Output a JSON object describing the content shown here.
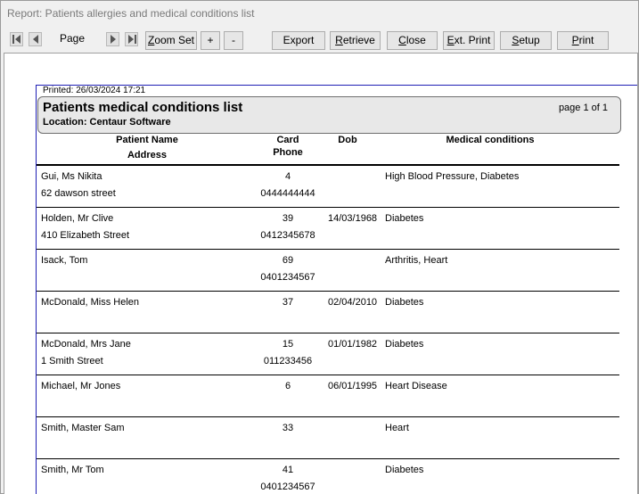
{
  "window": {
    "title": "Report: Patients allergies and medical conditions list"
  },
  "toolbar": {
    "page_label": "Page",
    "zoom_set": "Zoom Set",
    "zoom_in": "+",
    "zoom_out": "-",
    "export": "Export",
    "retrieve": "Retrieve",
    "close": "Close",
    "ext_print": "Ext. Print",
    "setup": "Setup",
    "print": "Print"
  },
  "report": {
    "printed": "Printed: 26/03/2024 17:21",
    "title": "Patients medical conditions list",
    "location": "Location: Centaur Software",
    "page": "page 1 of 1",
    "headers": {
      "patient_name": "Patient Name",
      "address": "Address",
      "card": "Card",
      "phone": "Phone",
      "dob": "Dob",
      "conditions": "Medical conditions"
    },
    "rows": [
      {
        "name": "Gui, Ms Nikita",
        "address": "62 dawson street",
        "card": "4",
        "phone": "0444444444",
        "dob": "",
        "conditions": "High Blood Pressure, Diabetes"
      },
      {
        "name": "Holden, Mr Clive",
        "address": "410 Elizabeth Street",
        "card": "39",
        "phone": "0412345678",
        "dob": "14/03/1968",
        "conditions": "Diabetes"
      },
      {
        "name": "Isack, Tom",
        "address": "",
        "card": "69",
        "phone": "0401234567",
        "dob": "",
        "conditions": "Arthritis, Heart"
      },
      {
        "name": "McDonald, Miss Helen",
        "address": "",
        "card": "37",
        "phone": "",
        "dob": "02/04/2010",
        "conditions": "Diabetes"
      },
      {
        "name": "McDonald, Mrs Jane",
        "address": "1 Smith Street",
        "card": "15",
        "phone": "011233456",
        "dob": "01/01/1982",
        "conditions": "Diabetes"
      },
      {
        "name": "Michael, Mr Jones",
        "address": "",
        "card": "6",
        "phone": "",
        "dob": "06/01/1995",
        "conditions": "Heart Disease"
      },
      {
        "name": "Smith, Master Sam",
        "address": "",
        "card": "33",
        "phone": "",
        "dob": "",
        "conditions": "Heart"
      },
      {
        "name": "Smith, Mr Tom",
        "address": "",
        "card": "41",
        "phone": "0401234567",
        "dob": "",
        "conditions": "Diabetes"
      }
    ]
  },
  "icons": {
    "first": "first-page-icon",
    "prev": "prev-page-icon",
    "next": "next-page-icon",
    "last": "last-page-icon"
  }
}
